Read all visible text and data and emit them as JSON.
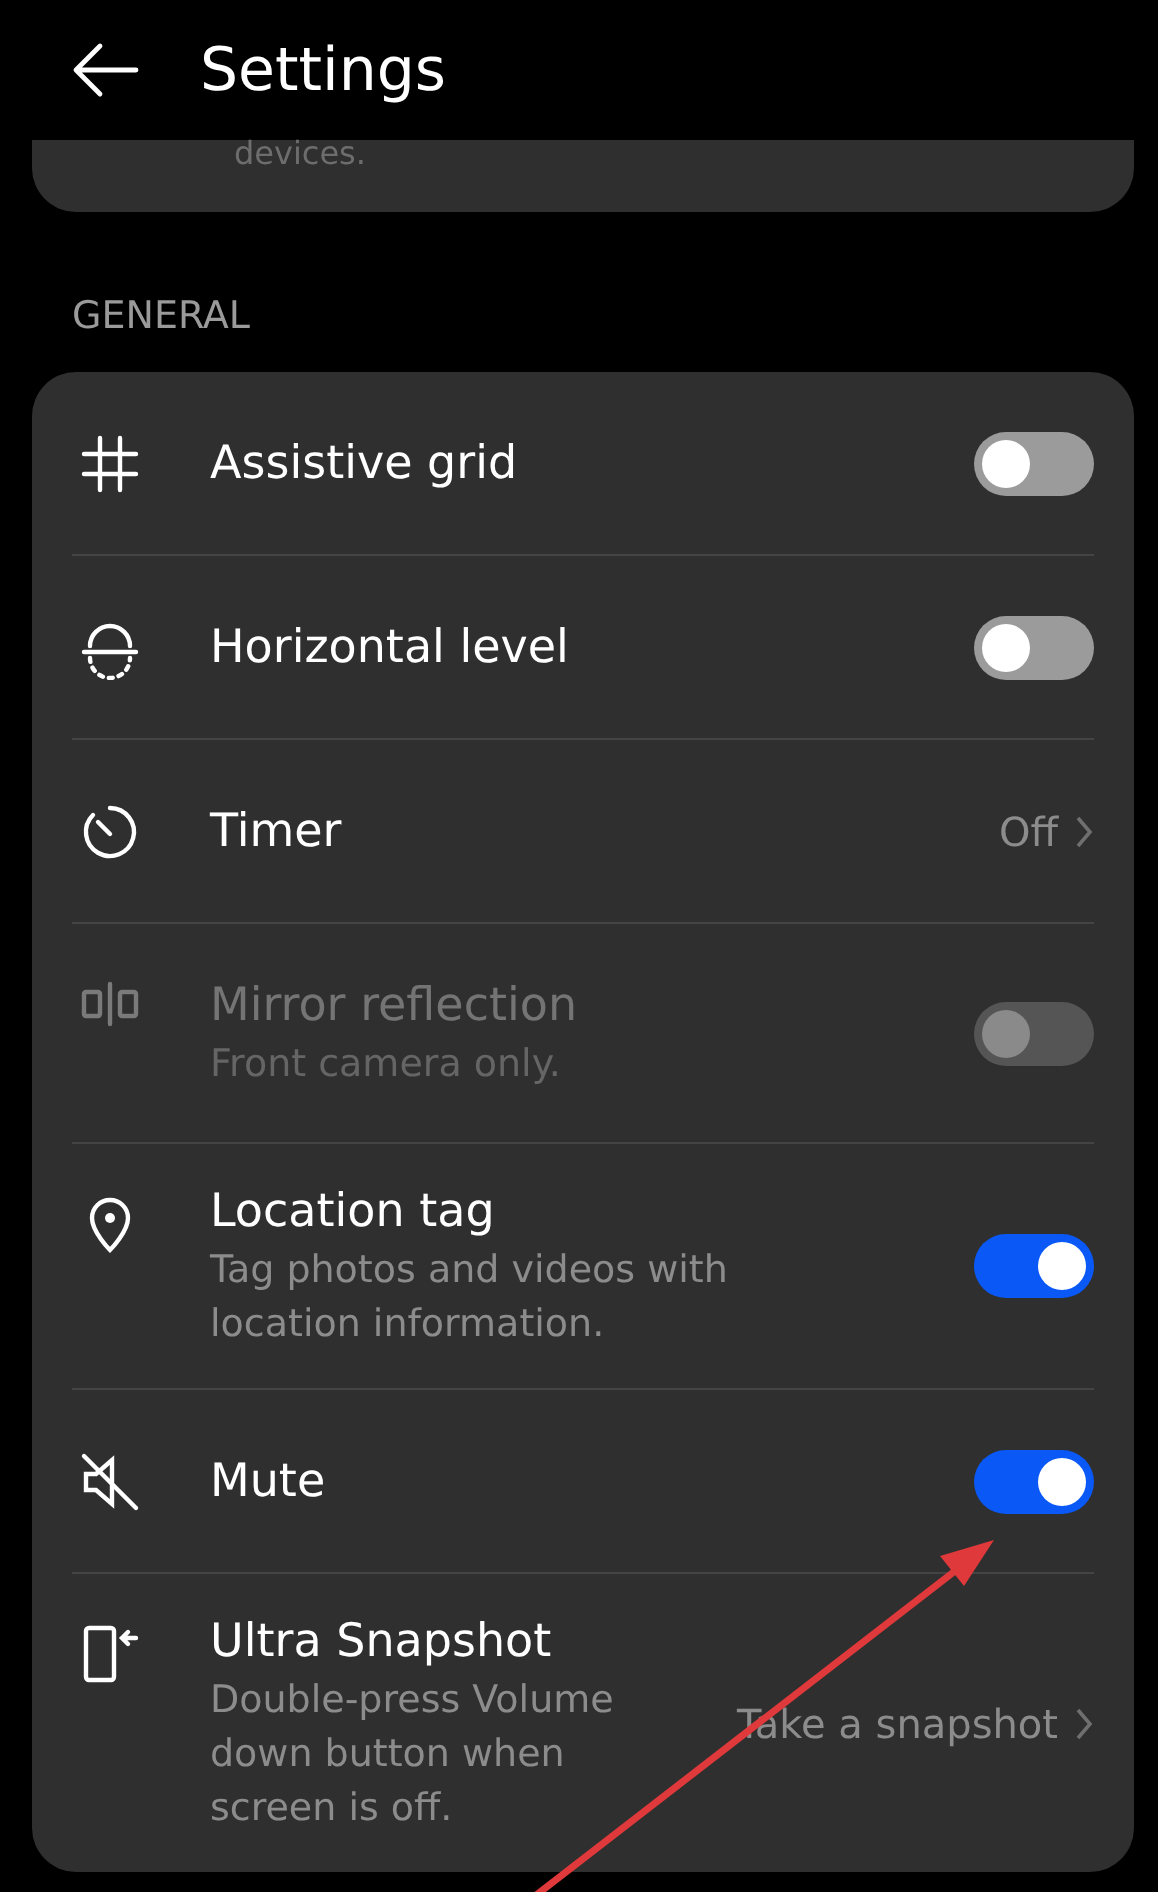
{
  "header": {
    "title": "Settings"
  },
  "previous_card": {
    "text": "devices."
  },
  "section": {
    "title": "GENERAL"
  },
  "items": [
    {
      "kind": "toggle",
      "title": "Assistive grid",
      "on": false,
      "disabled": false
    },
    {
      "kind": "toggle",
      "title": "Horizontal level",
      "on": false,
      "disabled": false
    },
    {
      "kind": "value",
      "title": "Timer",
      "value": "Off",
      "disabled": false
    },
    {
      "kind": "toggle",
      "title": "Mirror reflection",
      "subtitle": "Front camera only.",
      "on": false,
      "disabled": true
    },
    {
      "kind": "toggle",
      "title": "Location tag",
      "subtitle": "Tag photos and videos with location information.",
      "on": true,
      "disabled": false
    },
    {
      "kind": "toggle",
      "title": "Mute",
      "on": true,
      "disabled": false
    },
    {
      "kind": "value",
      "title": "Ultra Snapshot",
      "subtitle": "Double-press Volume down button when screen is off.",
      "value": "Take a snapshot",
      "disabled": false
    }
  ]
}
